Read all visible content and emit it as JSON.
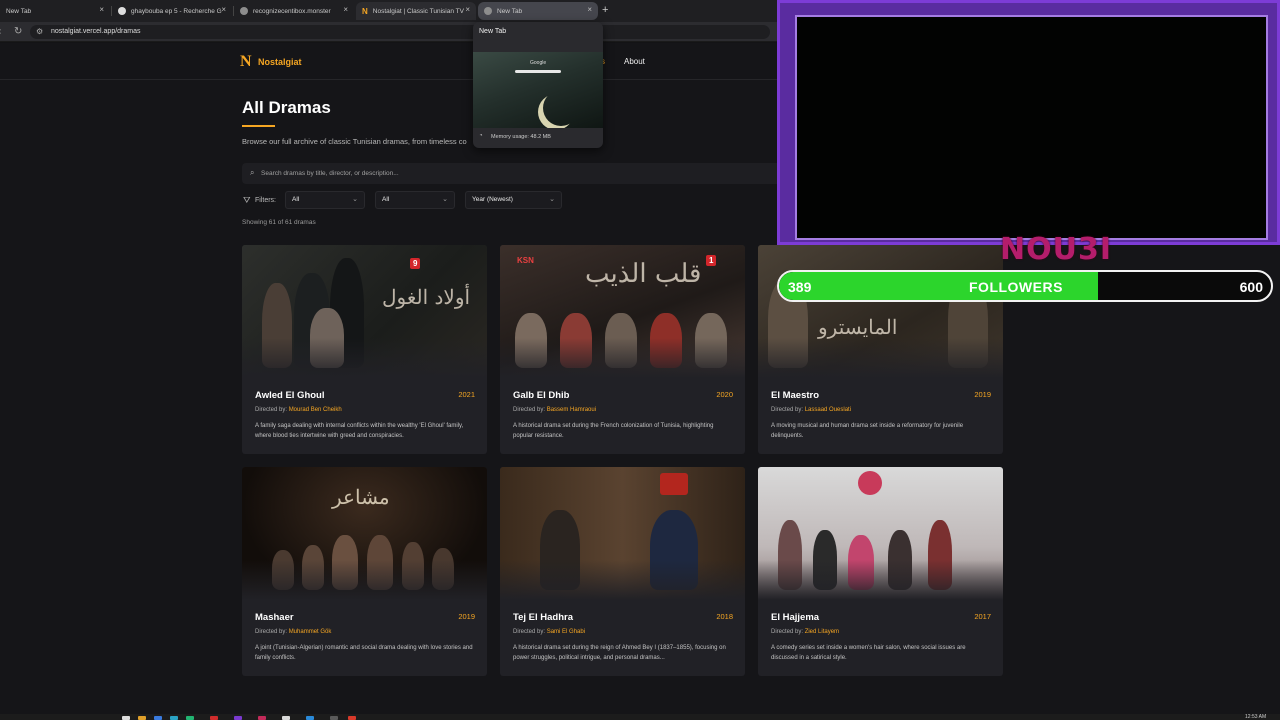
{
  "browser": {
    "tabs": [
      {
        "title": "New Tab"
      },
      {
        "title": "ghaybouba ep 5 - Recherche G"
      },
      {
        "title": "recognizecentibox.monster"
      },
      {
        "title": "Nostalgiat | Classic Tunisian TV"
      },
      {
        "title": "New Tab"
      }
    ],
    "close_glyph": "×",
    "new_tab_glyph": "+",
    "url": "nostalgiat.vercel.app/dramas"
  },
  "tab_preview": {
    "title": "New Tab",
    "logo_text": "Google",
    "memory": "Memory usage: 48.2 MB"
  },
  "site": {
    "logo_letter": "N",
    "logo_text": "Nostalgiat",
    "nav": {
      "dramas": "s",
      "about": "About"
    },
    "page_title": "All Dramas",
    "description": "Browse our full archive of classic Tunisian dramas, from timeless co",
    "search_placeholder": "Search dramas by title, director, or description...",
    "filters_label": "Filters:",
    "filter_genre": "All",
    "filter_channel": "All",
    "filter_sort": "Year (Newest)",
    "showing": "Showing 61 of 61 dramas",
    "directed_by_label": "Directed by:"
  },
  "dramas": [
    {
      "title": "Awled El Ghoul",
      "year": "2021",
      "director": "Mourad Ben Cheikh",
      "description": "A family saga dealing with internal conflicts within the wealthy 'El Ghoul' family, where blood ties intertwine with greed and conspiracies.",
      "poster_text": "أولاد الغول",
      "badge": "9"
    },
    {
      "title": "Galb El Dhib",
      "year": "2020",
      "director": "Bassem Hamraoui",
      "description": "A historical drama set during the French colonization of Tunisia, highlighting popular resistance.",
      "poster_text": "قلب الذيب",
      "badge": "KSN"
    },
    {
      "title": "El Maestro",
      "year": "2019",
      "director": "Lassaad Oueslati",
      "description": "A moving musical and human drama set inside a reformatory for juvenile delinquents.",
      "poster_text": "المايسترو",
      "badge": ""
    },
    {
      "title": "Mashaer",
      "year": "2019",
      "director": "Muhammet Gök",
      "description": "A joint (Tunisian-Algerian) romantic and social drama dealing with love stories and family conflicts.",
      "poster_text": "مشاعر",
      "badge": ""
    },
    {
      "title": "Tej El Hadhra",
      "year": "2018",
      "director": "Sami El Ghabi",
      "description": "A historical drama set during the reign of Ahmed Bey I (1837–1855), focusing on power struggles, political intrigue, and personal dramas...",
      "poster_text": "",
      "badge": ""
    },
    {
      "title": "El Hajjema",
      "year": "2017",
      "director": "Zied Litayem",
      "description": "A comedy series set inside a women's hair salon, where social issues are discussed in a satirical style.",
      "poster_text": "",
      "badge": ""
    }
  ],
  "overlay": {
    "streamer": "NOU3I",
    "followers_current": "389",
    "followers_label": "FOLLOWERS",
    "followers_goal": "600",
    "progress_fraction": 0.648
  },
  "taskbar": {
    "time": "12:53 AM"
  },
  "colors": {
    "accent": "#f5a623",
    "follow_bar": "#2cd52c",
    "cam_frame": "#5a2ca0"
  }
}
